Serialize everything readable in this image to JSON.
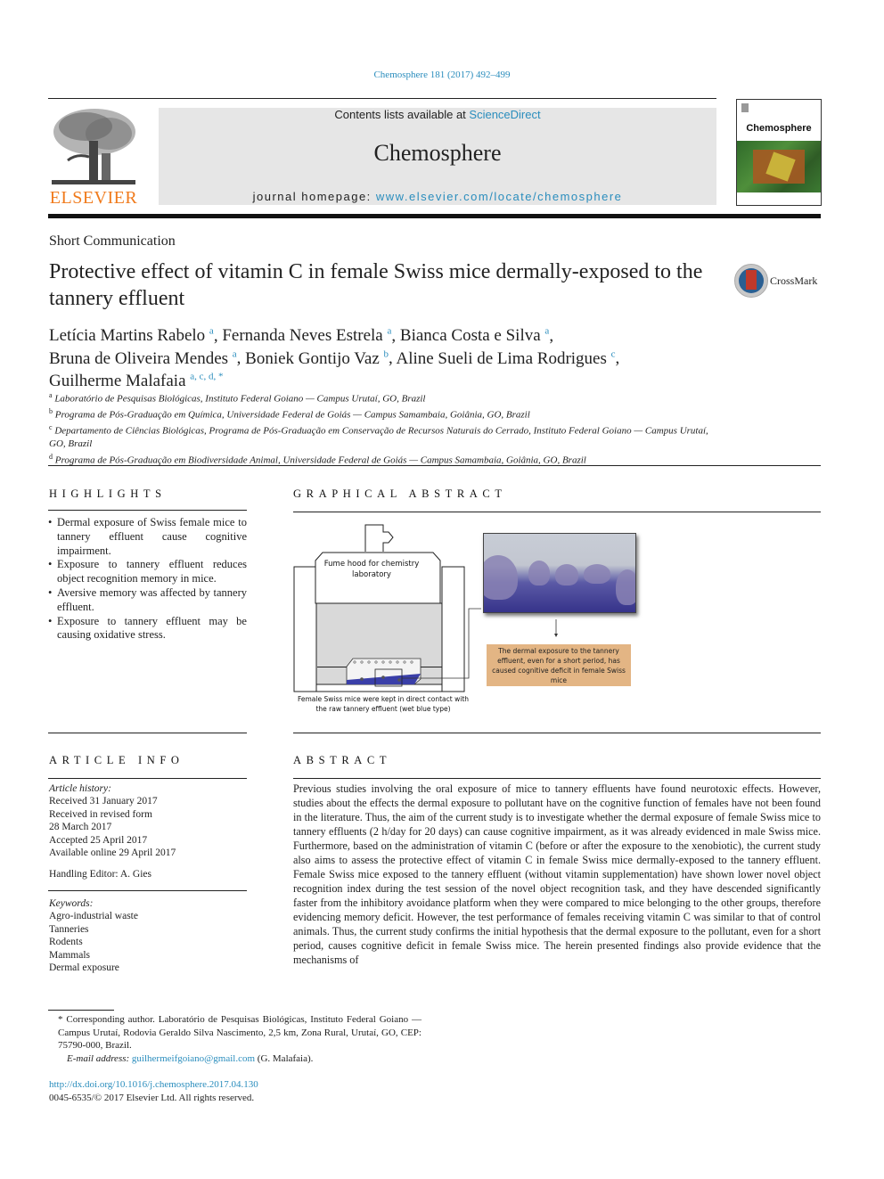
{
  "header": {
    "citation": "Chemosphere 181 (2017) 492–499",
    "publisher_logo_text": "ELSEVIER",
    "contents_prefix": "Contents lists available at ",
    "contents_link": "ScienceDirect",
    "journal_name": "Chemosphere",
    "homepage_prefix": "journal homepage: ",
    "homepage_link": "www.elsevier.com/locate/chemosphere",
    "cover_title": "Chemosphere",
    "colors": {
      "link": "#2a8dbd",
      "elsevier_orange": "#f07a1b",
      "banner_bg": "#e6e6e6"
    }
  },
  "article": {
    "type": "Short Communication",
    "title": "Protective effect of vitamin C in female Swiss mice dermally-exposed to the tannery effluent",
    "crossmark_label": "CrossMark",
    "authors": [
      {
        "name": "Letícia Martins Rabelo",
        "affil": "a"
      },
      {
        "name": "Fernanda Neves Estrela",
        "affil": "a"
      },
      {
        "name": "Bianca Costa e Silva",
        "affil": "a"
      },
      {
        "name": "Bruna de Oliveira Mendes",
        "affil": "a"
      },
      {
        "name": "Boniek Gontijo Vaz",
        "affil": "b"
      },
      {
        "name": "Aline Sueli de Lima Rodrigues",
        "affil": "c"
      },
      {
        "name": "Guilherme Malafaia",
        "affil": "a, c, d, *"
      }
    ],
    "affiliations": [
      {
        "key": "a",
        "text": "Laboratório de Pesquisas Biológicas, Instituto Federal Goiano — Campus Urutaí, GO, Brazil"
      },
      {
        "key": "b",
        "text": "Programa de Pós-Graduação em Química, Universidade Federal de Goiás — Campus Samambaia, Goiânia, GO, Brazil"
      },
      {
        "key": "c",
        "text": "Departamento de Ciências Biológicas, Programa de Pós-Graduação em Conservação de Recursos Naturais do Cerrado, Instituto Federal Goiano — Campus Urutaí, GO, Brazil"
      },
      {
        "key": "d",
        "text": "Programa de Pós-Graduação em Biodiversidade Animal, Universidade Federal de Goiás — Campus Samambaia, Goiânia, GO, Brazil"
      }
    ]
  },
  "highlights": {
    "heading": "HIGHLIGHTS",
    "items": [
      "Dermal exposure of Swiss female mice to tannery effluent cause cognitive impairment.",
      "Exposure to tannery effluent reduces object recognition memory in mice.",
      "Aversive memory was affected by tannery effluent.",
      "Exposure to tannery effluent may be causing oxidative stress."
    ]
  },
  "graphical_abstract": {
    "heading": "GRAPHICAL ABSTRACT",
    "hood_label": "Fume hood for chemistry laboratory",
    "bottom_caption": "Female Swiss mice were kept in direct contact with the raw tannery effluent (wet blue type)",
    "result_text": "The dermal exposure to the tannery effluent, even for a short period, has caused cognitive deficit in female Swiss mice",
    "colors": {
      "result_box": "#e3b584",
      "effluent": "#3a3fa8"
    }
  },
  "article_info": {
    "heading": "ARTICLE INFO",
    "history_label": "Article history:",
    "history": [
      "Received 31 January 2017",
      "Received in revised form",
      "28 March 2017",
      "Accepted 25 April 2017",
      "Available online 29 April 2017"
    ],
    "handling_editor": "Handling Editor: A. Gies",
    "keywords_label": "Keywords:",
    "keywords": [
      "Agro-industrial waste",
      "Tanneries",
      "Rodents",
      "Mammals",
      "Dermal exposure"
    ]
  },
  "abstract": {
    "heading": "ABSTRACT",
    "text": "Previous studies involving the oral exposure of mice to tannery effluents have found neurotoxic effects. However, studies about the effects the dermal exposure to pollutant have on the cognitive function of females have not been found in the literature. Thus, the aim of the current study is to investigate whether the dermal exposure of female Swiss mice to tannery effluents (2 h/day for 20 days) can cause cognitive impairment, as it was already evidenced in male Swiss mice. Furthermore, based on the administration of vitamin C (before or after the exposure to the xenobiotic), the current study also aims to assess the protective effect of vitamin C in female Swiss mice dermally-exposed to the tannery effluent. Female Swiss mice exposed to the tannery effluent (without vitamin supplementation) have shown lower novel object recognition index during the test session of the novel object recognition task, and they have descended significantly faster from the inhibitory avoidance platform when they were compared to mice belonging to the other groups, therefore evidencing memory deficit. However, the test performance of females receiving vitamin C was similar to that of control animals. Thus, the current study confirms the initial hypothesis that the dermal exposure to the pollutant, even for a short period, causes cognitive deficit in female Swiss mice. The herein presented findings also provide evidence that the mechanisms of"
  },
  "footnote": {
    "corresponding": "* Corresponding author. Laboratório de Pesquisas Biológicas, Instituto Federal Goiano — Campus Urutaí, Rodovia Geraldo Silva Nascimento, 2,5 km, Zona Rural, Urutaí, GO, CEP: 75790-000, Brazil.",
    "email_label": "E-mail address: ",
    "email": "guilhermeifgoiano@gmail.com",
    "email_suffix": " (G. Malafaia).",
    "doi": "http://dx.doi.org/10.1016/j.chemosphere.2017.04.130",
    "copyright": "0045-6535/© 2017 Elsevier Ltd. All rights reserved."
  }
}
